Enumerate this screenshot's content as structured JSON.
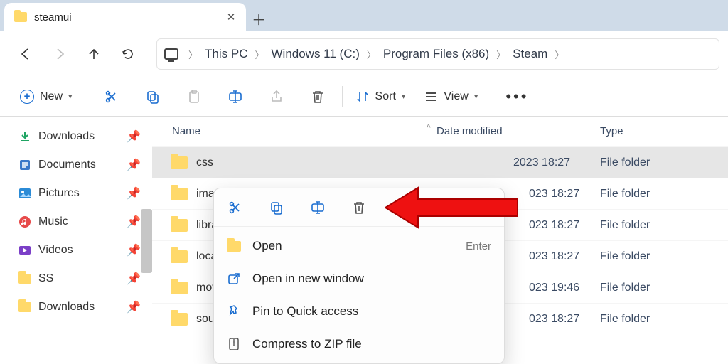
{
  "tab": {
    "title": "steamui"
  },
  "breadcrumb": [
    "This PC",
    "Windows 11 (C:)",
    "Program Files (x86)",
    "Steam"
  ],
  "toolbar": {
    "new_label": "New",
    "sort_label": "Sort",
    "view_label": "View"
  },
  "columns": {
    "name": "Name",
    "date": "Date modified",
    "type": "Type"
  },
  "sidebar": [
    {
      "label": "Downloads",
      "icon": "download"
    },
    {
      "label": "Documents",
      "icon": "document"
    },
    {
      "label": "Pictures",
      "icon": "pictures"
    },
    {
      "label": "Music",
      "icon": "music"
    },
    {
      "label": "Videos",
      "icon": "videos"
    },
    {
      "label": "SS",
      "icon": "folder"
    },
    {
      "label": "Downloads",
      "icon": "folder"
    }
  ],
  "rows": [
    {
      "name": "css",
      "date": "023 18:27",
      "type": "File folder",
      "sel": true
    },
    {
      "name": "ima",
      "date": "023 18:27",
      "type": "File folder"
    },
    {
      "name": "libra",
      "date": "023 18:27",
      "type": "File folder"
    },
    {
      "name": "local",
      "date": "023 18:27",
      "type": "File folder"
    },
    {
      "name": "mov",
      "date": "023 19:46",
      "type": "File folder"
    },
    {
      "name": "sour",
      "date": "023 18:27",
      "type": "File folder"
    }
  ],
  "row0_date_full": "2023 18:27",
  "context_menu": {
    "open": "Open",
    "open_accel": "Enter",
    "open_new": "Open in new window",
    "pin": "Pin to Quick access",
    "compress": "Compress to ZIP file"
  }
}
